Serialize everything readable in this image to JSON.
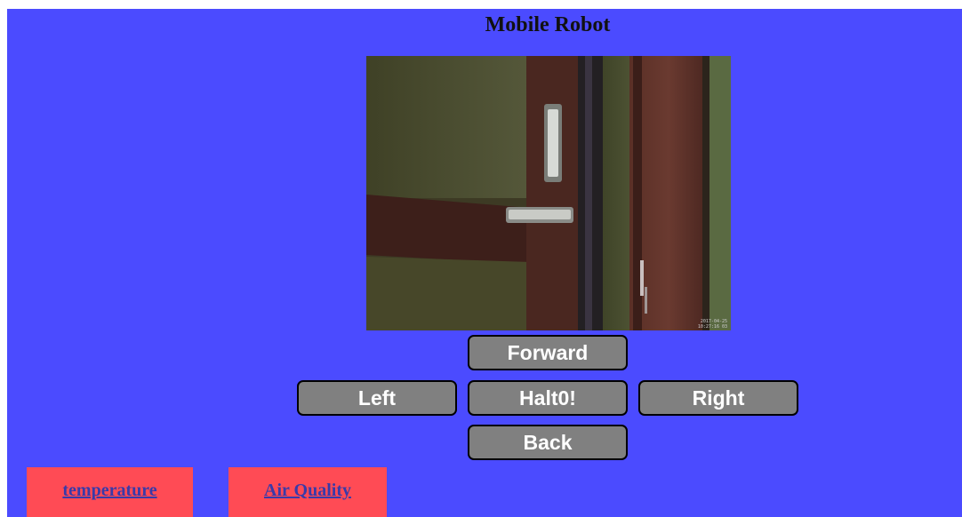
{
  "header": {
    "title": "Mobile Robot"
  },
  "camera": {
    "stamp_date": "2017-04-25",
    "stamp_time": "10:27:16 03"
  },
  "controls": {
    "forward_label": "Forward",
    "left_label": "Left",
    "halt_label": "Halt0!",
    "right_label": "Right",
    "back_label": "Back"
  },
  "links": {
    "temperature_label": "temperature",
    "air_quality_label": "Air Quality"
  },
  "colors": {
    "page_background": "#4b4bff",
    "button_background": "#808080",
    "link_tile_background": "#ff4b55",
    "link_text": "#3a3aa8"
  }
}
